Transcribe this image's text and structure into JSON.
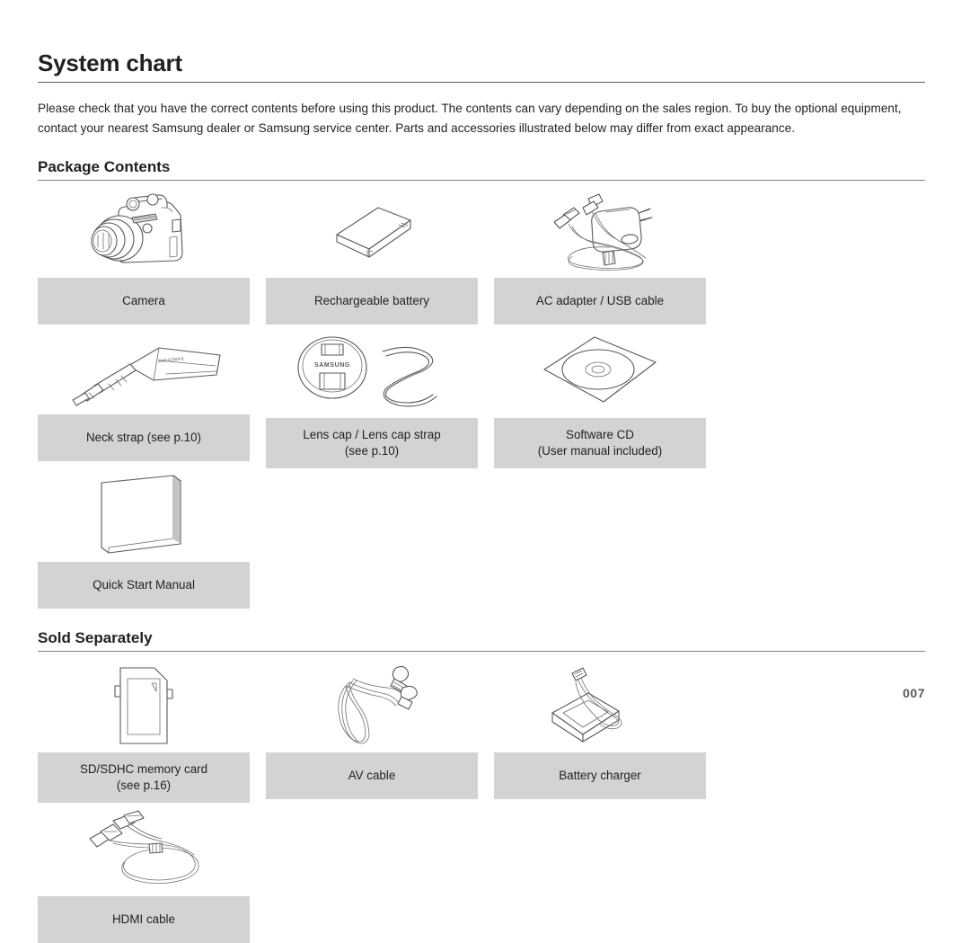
{
  "document": {
    "title": "System chart",
    "intro": "Please check that you have the correct contents before using this product. The contents can vary depending on the sales region. To buy the optional equipment, contact your nearest Samsung dealer or Samsung service center. Parts and accessories illustrated below may differ from exact appearance.",
    "page_number": "007"
  },
  "sections": [
    {
      "heading": "Package Contents",
      "items": [
        {
          "icon": "camera-icon",
          "label_line1": "Camera",
          "label_line2": ""
        },
        {
          "icon": "battery-icon",
          "label_line1": "Rechargeable battery",
          "label_line2": ""
        },
        {
          "icon": "ac-adapter-usb-cable-icon",
          "label_line1": "AC adapter / USB cable",
          "label_line2": ""
        },
        {
          "icon": "neck-strap-icon",
          "label_line1": "Neck strap (see p.10)",
          "label_line2": ""
        },
        {
          "icon": "lens-cap-icon",
          "label_line1": "Lens cap / Lens cap strap",
          "label_line2": "(see p.10)"
        },
        {
          "icon": "software-cd-icon",
          "label_line1": "Software CD",
          "label_line2": "(User manual included)"
        },
        {
          "icon": "quick-start-manual-icon",
          "label_line1": "Quick Start Manual",
          "label_line2": ""
        }
      ]
    },
    {
      "heading": "Sold Separately",
      "items": [
        {
          "icon": "sd-card-icon",
          "label_line1": "SD/SDHC memory card",
          "label_line2": "(see p.16)"
        },
        {
          "icon": "av-cable-icon",
          "label_line1": "AV cable",
          "label_line2": ""
        },
        {
          "icon": "battery-charger-icon",
          "label_line1": "Battery charger",
          "label_line2": ""
        },
        {
          "icon": "hdmi-cable-icon",
          "label_line1": "HDMI cable",
          "label_line2": ""
        }
      ]
    }
  ],
  "brand_marks": {
    "neck_strap": "SAMSUNG",
    "lens_cap": "SAMSUNG"
  },
  "colors": {
    "text": "#231f20",
    "label_background": "#d1d3d4",
    "line_art": "#58595b",
    "rule": "#808285"
  }
}
